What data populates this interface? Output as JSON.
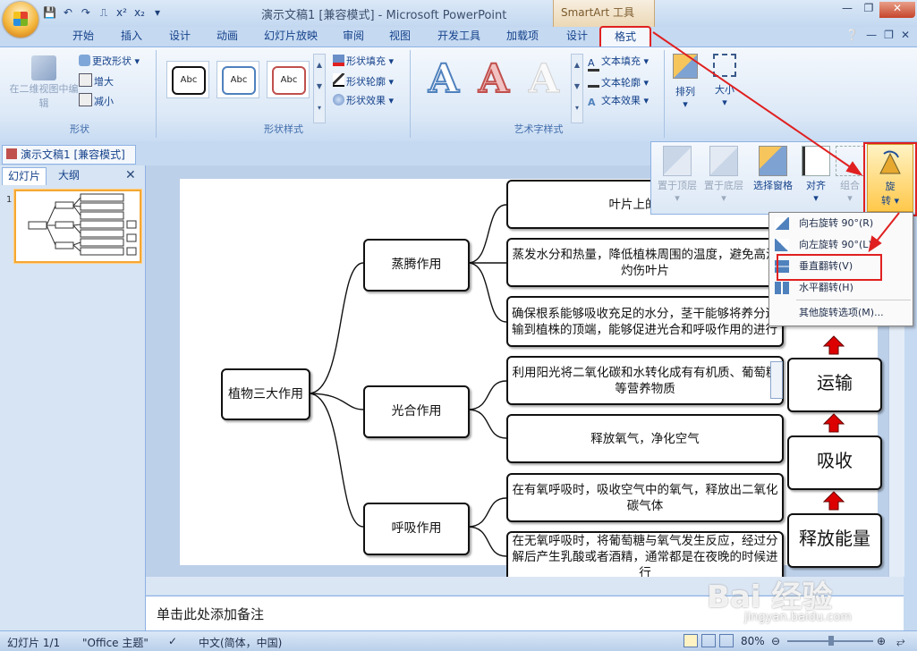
{
  "window": {
    "title": "演示文稿1 [兼容模式] - Microsoft PowerPoint",
    "context_tab_header": "SmartArt 工具"
  },
  "tabs": [
    "开始",
    "插入",
    "设计",
    "动画",
    "幻灯片放映",
    "审阅",
    "视图",
    "开发工具",
    "加载项",
    "设计",
    "格式"
  ],
  "ribbon": {
    "shape_group": {
      "label": "形状",
      "edit_2d": "在二维视图中编辑",
      "change_shape": "更改形状",
      "larger": "增大",
      "smaller": "减小"
    },
    "shape_styles": {
      "label": "形状样式",
      "sample": "Abc",
      "fill": "形状填充",
      "outline": "形状轮廓",
      "effects": "形状效果"
    },
    "wordart": {
      "label": "艺术字样式",
      "glyph": "A",
      "text_fill": "文本填充",
      "text_outline": "文本轮廓",
      "text_effects": "文本效果"
    },
    "arrange": "排列",
    "size": "大小"
  },
  "arrange_panel": {
    "bring_front": "置于顶层",
    "send_back": "置于底层",
    "selection_pane": "选择窗格",
    "align": "对齐",
    "group": "组合",
    "rotate_line1": "旋",
    "rotate_line2": "转"
  },
  "rotate_menu": {
    "items": [
      "向右旋转 90°(R)",
      "向左旋转 90°(L)",
      "垂直翻转(V)",
      "水平翻转(H)",
      "其他旋转选项(M)..."
    ]
  },
  "document_tab": "演示文稿1 [兼容模式]",
  "panel_tabs": {
    "slides": "幻灯片",
    "outline": "大纲"
  },
  "slide_number": "1",
  "diagram": {
    "root": "植物三大作用",
    "branches": [
      {
        "label": "蒸腾作用",
        "leaves": [
          "叶片上的气孔",
          "蒸发水分和热量，降低植株周围的温度，避免高温灼伤叶片",
          "确保根系能够吸收充足的水分，茎干能够将养分运输到植株的顶端，能够促进光合和呼吸作用的进行"
        ]
      },
      {
        "label": "光合作用",
        "leaves": [
          "利用阳光将二氧化碳和水转化成有有机质、葡萄糖等营养物质",
          "释放氧气，净化空气"
        ]
      },
      {
        "label": "呼吸作用",
        "leaves": [
          "在有氧呼吸时，吸收空气中的氧气，释放出二氧化碳气体",
          "在无氧呼吸时，将葡萄糖与氧气发生反应，经过分解后产生乳酸或者酒精，通常都是在夜晚的时候进行"
        ]
      }
    ],
    "right_boxes": [
      "运输",
      "吸收",
      "释放能量"
    ]
  },
  "notes_placeholder": "单击此处添加备注",
  "status": {
    "slide": "幻灯片 1/1",
    "theme": "\"Office 主题\"",
    "language": "中文(简体，中国)",
    "zoom": "80%"
  },
  "watermark": {
    "main": "Bai 经验",
    "sub": "jingyan.baidu.com"
  }
}
